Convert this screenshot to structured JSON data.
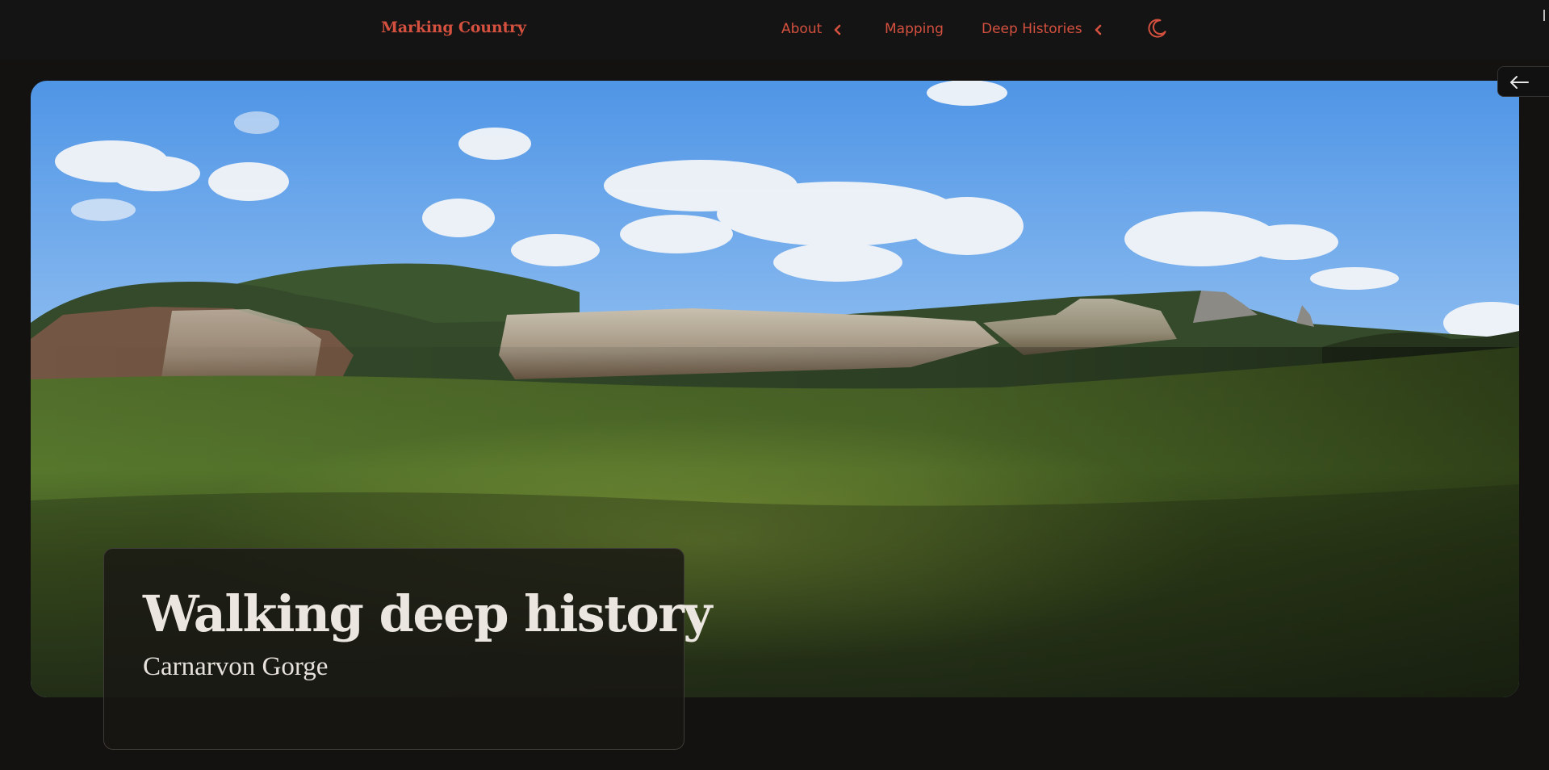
{
  "header": {
    "brand": "Marking Country",
    "nav": [
      {
        "label": "About",
        "has_dropdown": true
      },
      {
        "label": "Mapping",
        "has_dropdown": false
      },
      {
        "label": "Deep Histories",
        "has_dropdown": true
      }
    ],
    "theme_toggle_icon": "moon-icon",
    "accent_color": "#d4503f"
  },
  "hero": {
    "image_subject": "cliff-lined sandstone escarpment above forested valley under blue sky with clouds",
    "back_icon": "arrow-left-icon"
  },
  "caption": {
    "title": "Walking deep history",
    "subtitle": "Carnarvon Gorge"
  }
}
